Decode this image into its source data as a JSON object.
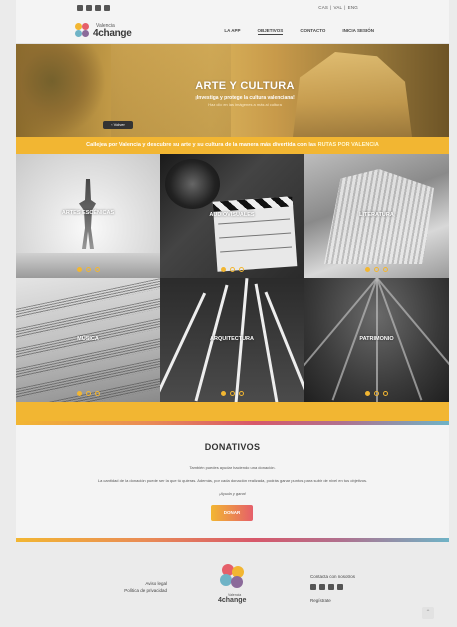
{
  "topbar": {
    "social_icons": [
      "instagram-icon",
      "facebook-icon",
      "twitter-icon",
      "mail-icon"
    ],
    "languages": [
      "CAS",
      "VAL",
      "ENG"
    ],
    "separator": "|"
  },
  "brand": {
    "sub": "Valencia",
    "name": "4change",
    "colors": [
      "#f2b632",
      "#e55f6a",
      "#6fb3c6",
      "#8b6a9a"
    ]
  },
  "nav": {
    "items": [
      {
        "label": "LA APP",
        "active": false
      },
      {
        "label": "OBJETIVOS",
        "active": true
      },
      {
        "label": "CONTACTO",
        "active": false
      },
      {
        "label": "INICIA SESIÓN",
        "active": false
      }
    ]
  },
  "hero": {
    "title": "ARTE Y CULTURA",
    "subtitle": "¡Investiga y protege la cultura valenciana!",
    "subtitle2": "Haz clic en las imágenes a más al cultura",
    "back_label": "‹ Volver"
  },
  "strip": {
    "text": "Callejea por Valencia y descubre su arte y su cultura de la manera más divertida con las",
    "highlight": "RUTAS POR VALENCIA"
  },
  "tiles": [
    {
      "label": "ARTES ESCÉNICAS",
      "active_dot": 0
    },
    {
      "label": "AUDIOVISUALES",
      "active_dot": 0
    },
    {
      "label": "LITERATURA",
      "active_dot": 0
    },
    {
      "label": "MÚSICA",
      "active_dot": 0
    },
    {
      "label": "ARQUITECTURA",
      "active_dot": 0
    },
    {
      "label": "PATRIMONIO",
      "active_dot": 0
    }
  ],
  "donations": {
    "title": "DONATIVOS",
    "p1": "También puedes ayudar haciendo una donación.",
    "p2": "La cantidad de la donación puede ser la que tú quieras. Además, por cada donación realizada, podrás ganar puntos para subir de nivel en tus objetivos.",
    "p3": "¡Ayuda y gana!",
    "button": "DONAR"
  },
  "footer": {
    "legal": "Aviso legal",
    "privacy": "Política de privacidad",
    "contact": "Contacta con nosotros",
    "register": "Regístrate",
    "logo_sub": "Valencia",
    "logo_name": "4change",
    "to_top": "⌃"
  },
  "colors": {
    "accent": "#f2b632",
    "pink": "#e55f6a",
    "teal": "#6fb3c6"
  }
}
